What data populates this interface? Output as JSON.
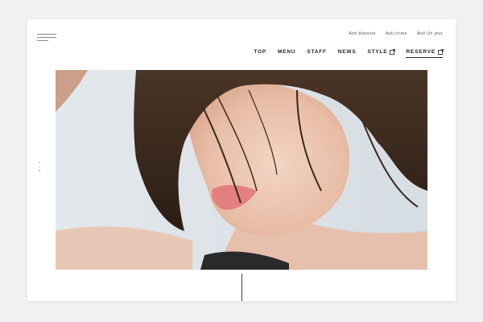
{
  "header": {
    "sub_nav": [
      "Asti blanche",
      "Asti crime",
      "Asti Un jour"
    ],
    "main_nav": [
      {
        "label": "TOP",
        "external": false
      },
      {
        "label": "MENU",
        "external": false
      },
      {
        "label": "STAFF",
        "external": false
      },
      {
        "label": "NEWS",
        "external": false
      },
      {
        "label": "STYLE",
        "external": true
      },
      {
        "label": "RESERVE",
        "external": true
      }
    ]
  },
  "side_pager": [
    "1",
    "/",
    "3"
  ],
  "hero": {
    "alt": "close-up portrait photo of woman with short bob hair",
    "icon": "hero-photo"
  }
}
